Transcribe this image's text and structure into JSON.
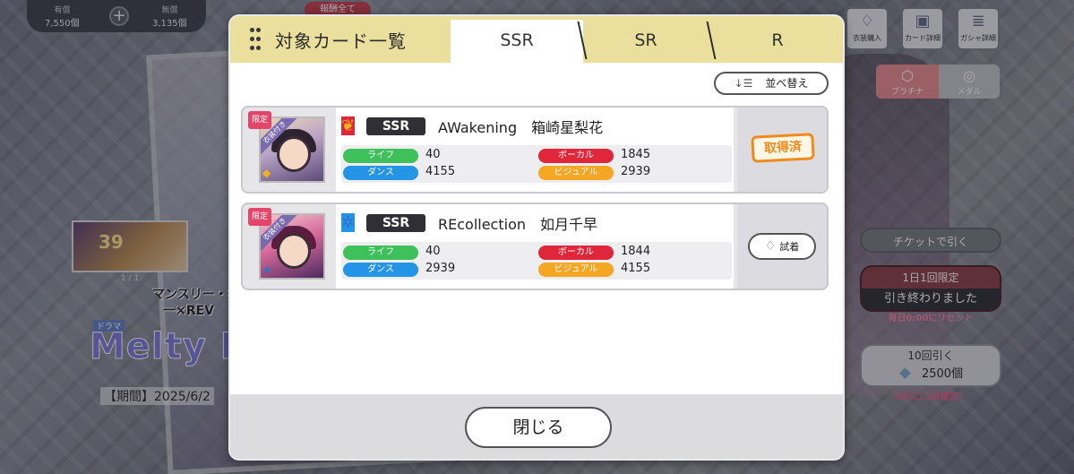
{
  "currency": {
    "paid_label": "有償",
    "paid_value": "7,550個",
    "free_label": "無償",
    "free_value": "3,135個"
  },
  "top_bar": {
    "reward_chip": "報酬全て"
  },
  "right_menu": {
    "costume_buy": "衣装購入",
    "card_detail": "カード詳細",
    "gacha_detail": "ガシャ詳細",
    "platinum": "プラチナ",
    "medal": "メダル"
  },
  "gacha_panel": {
    "ticket_button": "チケットで引く",
    "daily_limit_line1": "1日1回限定",
    "daily_limit_line2": "引き終わりました",
    "daily_reset_note": "毎日0:00にリセット",
    "ten_pull_label": "10回引く",
    "ten_pull_cost": "2500個",
    "ten_pull_note": "SR以上1枚確定！"
  },
  "banner": {
    "thumb_text": "39",
    "page_count": "1 / 1",
    "monthly_line1": "マンスリー・オ",
    "monthly_line2": "一×REV",
    "drama_tag": "ドラマ",
    "title": "Melty F",
    "period": "【期間】2025/6/2"
  },
  "modal": {
    "title": "対象カード一覧",
    "tabs": [
      {
        "label": "SSR",
        "active": true
      },
      {
        "label": "SR",
        "active": false
      },
      {
        "label": "R",
        "active": false
      }
    ],
    "sort_button": "並べ替え",
    "cards": [
      {
        "limited": "限定",
        "costume": "衣装付き",
        "attribute_icon": "vocal-wing-icon",
        "rarity": "SSR",
        "name": "AWakening　箱崎星梨花",
        "stats": {
          "life_label": "ライフ",
          "life": "40",
          "dance_label": "ダンス",
          "dance": "4155",
          "vocal_label": "ボーカル",
          "vocal": "1845",
          "visual_label": "ビジュアル",
          "visual": "2939"
        },
        "status": "取得済"
      },
      {
        "limited": "限定",
        "costume": "衣装付き",
        "attribute_icon": "dance-star-icon",
        "rarity": "SSR",
        "name": "REcollection　如月千早",
        "stats": {
          "life_label": "ライフ",
          "life": "40",
          "dance_label": "ダンス",
          "dance": "2939",
          "vocal_label": "ボーカル",
          "vocal": "1844",
          "visual_label": "ビジュアル",
          "visual": "4155"
        },
        "try_on": "試着"
      }
    ],
    "close_button": "閉じる"
  }
}
